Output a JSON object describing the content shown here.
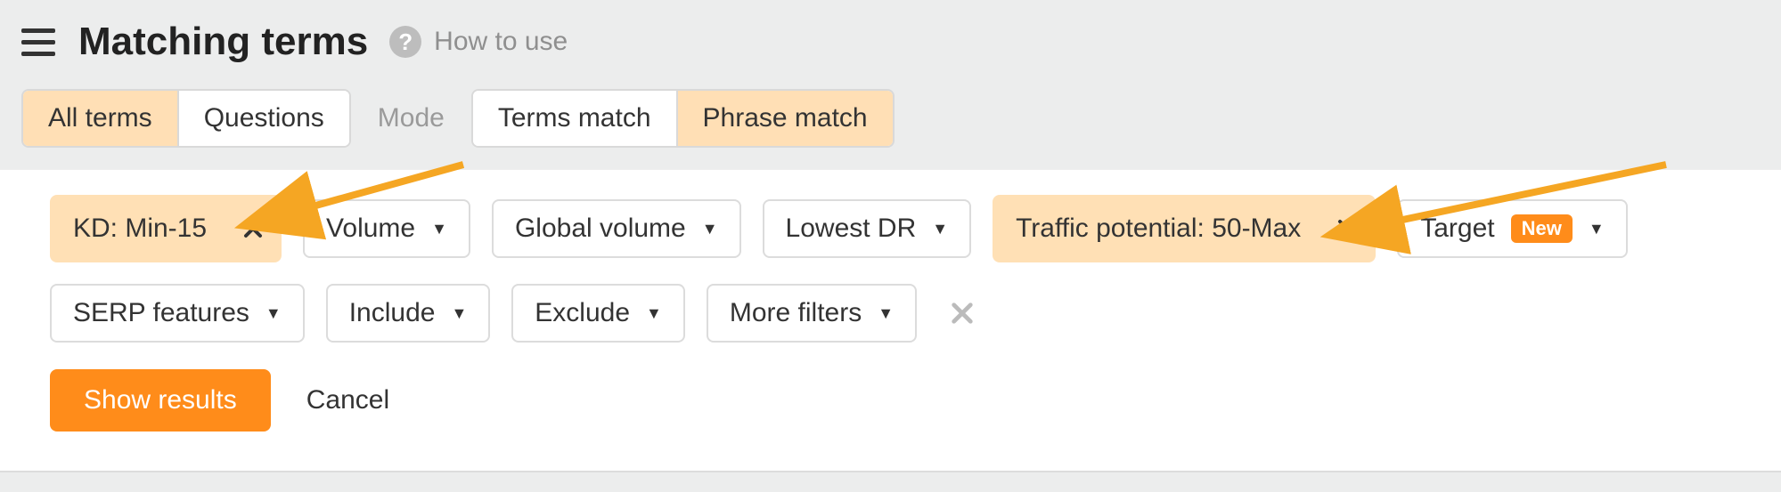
{
  "header": {
    "page_title": "Matching terms",
    "how_to_use_label": "How to use"
  },
  "tabs": {
    "group1": {
      "items": [
        {
          "label": "All terms",
          "active": true
        },
        {
          "label": "Questions",
          "active": false
        }
      ]
    },
    "mode_label": "Mode",
    "group2": {
      "items": [
        {
          "label": "Terms match",
          "active": false
        },
        {
          "label": "Phrase match",
          "active": true
        }
      ]
    }
  },
  "filters": {
    "row1": {
      "kd": {
        "label": "KD: Min-15",
        "active": true
      },
      "volume": {
        "label": "Volume"
      },
      "global_volume": {
        "label": "Global volume"
      },
      "lowest_dr": {
        "label": "Lowest DR"
      },
      "traffic_potential": {
        "label": "Traffic potential: 50-Max",
        "active": true
      },
      "target": {
        "label": "Target",
        "badge": "New"
      }
    },
    "row2": {
      "serp_features": {
        "label": "SERP features"
      },
      "include": {
        "label": "Include"
      },
      "exclude": {
        "label": "Exclude"
      },
      "more_filters": {
        "label": "More filters"
      }
    }
  },
  "actions": {
    "show_results": "Show results",
    "cancel": "Cancel"
  },
  "colors": {
    "accent": "#ff8c1a",
    "active_chip_bg": "#ffe0b5",
    "panel_bg": "#ffffff",
    "page_bg": "#eceded"
  }
}
